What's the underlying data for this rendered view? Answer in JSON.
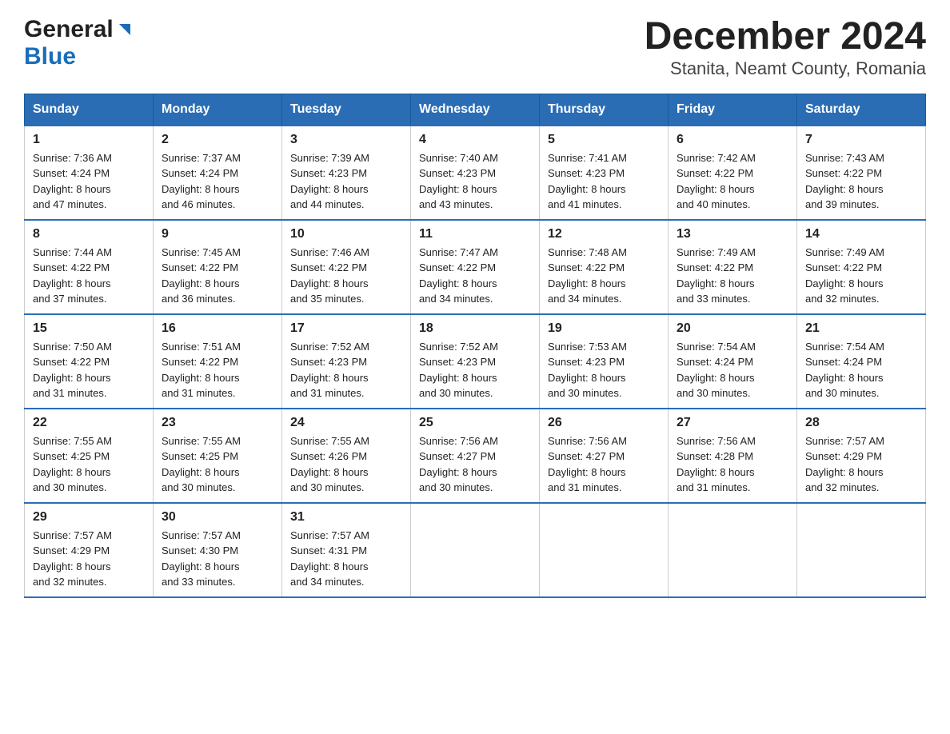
{
  "header": {
    "logo_general": "General",
    "logo_blue": "Blue",
    "title": "December 2024",
    "subtitle": "Stanita, Neamt County, Romania"
  },
  "days_of_week": [
    "Sunday",
    "Monday",
    "Tuesday",
    "Wednesday",
    "Thursday",
    "Friday",
    "Saturday"
  ],
  "weeks": [
    [
      {
        "day": "1",
        "sunrise": "7:36 AM",
        "sunset": "4:24 PM",
        "daylight": "8 hours and 47 minutes."
      },
      {
        "day": "2",
        "sunrise": "7:37 AM",
        "sunset": "4:24 PM",
        "daylight": "8 hours and 46 minutes."
      },
      {
        "day": "3",
        "sunrise": "7:39 AM",
        "sunset": "4:23 PM",
        "daylight": "8 hours and 44 minutes."
      },
      {
        "day": "4",
        "sunrise": "7:40 AM",
        "sunset": "4:23 PM",
        "daylight": "8 hours and 43 minutes."
      },
      {
        "day": "5",
        "sunrise": "7:41 AM",
        "sunset": "4:23 PM",
        "daylight": "8 hours and 41 minutes."
      },
      {
        "day": "6",
        "sunrise": "7:42 AM",
        "sunset": "4:22 PM",
        "daylight": "8 hours and 40 minutes."
      },
      {
        "day": "7",
        "sunrise": "7:43 AM",
        "sunset": "4:22 PM",
        "daylight": "8 hours and 39 minutes."
      }
    ],
    [
      {
        "day": "8",
        "sunrise": "7:44 AM",
        "sunset": "4:22 PM",
        "daylight": "8 hours and 37 minutes."
      },
      {
        "day": "9",
        "sunrise": "7:45 AM",
        "sunset": "4:22 PM",
        "daylight": "8 hours and 36 minutes."
      },
      {
        "day": "10",
        "sunrise": "7:46 AM",
        "sunset": "4:22 PM",
        "daylight": "8 hours and 35 minutes."
      },
      {
        "day": "11",
        "sunrise": "7:47 AM",
        "sunset": "4:22 PM",
        "daylight": "8 hours and 34 minutes."
      },
      {
        "day": "12",
        "sunrise": "7:48 AM",
        "sunset": "4:22 PM",
        "daylight": "8 hours and 34 minutes."
      },
      {
        "day": "13",
        "sunrise": "7:49 AM",
        "sunset": "4:22 PM",
        "daylight": "8 hours and 33 minutes."
      },
      {
        "day": "14",
        "sunrise": "7:49 AM",
        "sunset": "4:22 PM",
        "daylight": "8 hours and 32 minutes."
      }
    ],
    [
      {
        "day": "15",
        "sunrise": "7:50 AM",
        "sunset": "4:22 PM",
        "daylight": "8 hours and 31 minutes."
      },
      {
        "day": "16",
        "sunrise": "7:51 AM",
        "sunset": "4:22 PM",
        "daylight": "8 hours and 31 minutes."
      },
      {
        "day": "17",
        "sunrise": "7:52 AM",
        "sunset": "4:23 PM",
        "daylight": "8 hours and 31 minutes."
      },
      {
        "day": "18",
        "sunrise": "7:52 AM",
        "sunset": "4:23 PM",
        "daylight": "8 hours and 30 minutes."
      },
      {
        "day": "19",
        "sunrise": "7:53 AM",
        "sunset": "4:23 PM",
        "daylight": "8 hours and 30 minutes."
      },
      {
        "day": "20",
        "sunrise": "7:54 AM",
        "sunset": "4:24 PM",
        "daylight": "8 hours and 30 minutes."
      },
      {
        "day": "21",
        "sunrise": "7:54 AM",
        "sunset": "4:24 PM",
        "daylight": "8 hours and 30 minutes."
      }
    ],
    [
      {
        "day": "22",
        "sunrise": "7:55 AM",
        "sunset": "4:25 PM",
        "daylight": "8 hours and 30 minutes."
      },
      {
        "day": "23",
        "sunrise": "7:55 AM",
        "sunset": "4:25 PM",
        "daylight": "8 hours and 30 minutes."
      },
      {
        "day": "24",
        "sunrise": "7:55 AM",
        "sunset": "4:26 PM",
        "daylight": "8 hours and 30 minutes."
      },
      {
        "day": "25",
        "sunrise": "7:56 AM",
        "sunset": "4:27 PM",
        "daylight": "8 hours and 30 minutes."
      },
      {
        "day": "26",
        "sunrise": "7:56 AM",
        "sunset": "4:27 PM",
        "daylight": "8 hours and 31 minutes."
      },
      {
        "day": "27",
        "sunrise": "7:56 AM",
        "sunset": "4:28 PM",
        "daylight": "8 hours and 31 minutes."
      },
      {
        "day": "28",
        "sunrise": "7:57 AM",
        "sunset": "4:29 PM",
        "daylight": "8 hours and 32 minutes."
      }
    ],
    [
      {
        "day": "29",
        "sunrise": "7:57 AM",
        "sunset": "4:29 PM",
        "daylight": "8 hours and 32 minutes."
      },
      {
        "day": "30",
        "sunrise": "7:57 AM",
        "sunset": "4:30 PM",
        "daylight": "8 hours and 33 minutes."
      },
      {
        "day": "31",
        "sunrise": "7:57 AM",
        "sunset": "4:31 PM",
        "daylight": "8 hours and 34 minutes."
      },
      null,
      null,
      null,
      null
    ]
  ],
  "labels": {
    "sunrise": "Sunrise:",
    "sunset": "Sunset:",
    "daylight": "Daylight:"
  }
}
